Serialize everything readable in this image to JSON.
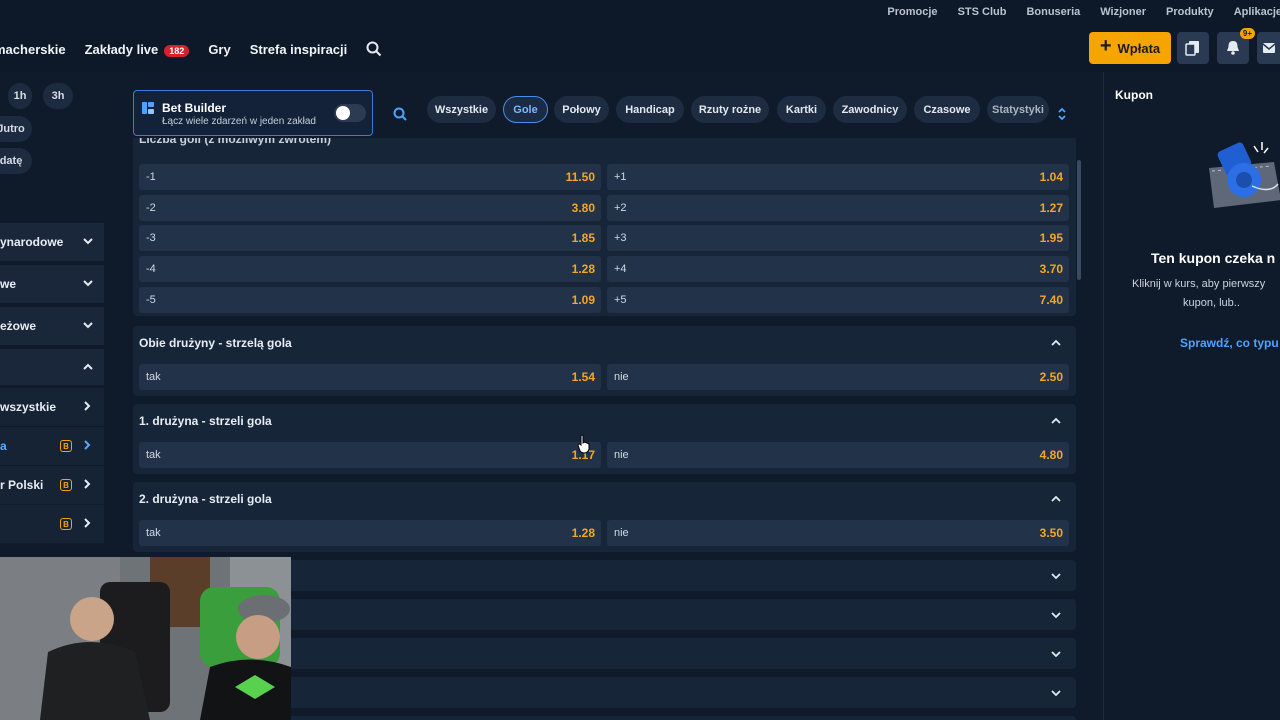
{
  "util_links": [
    "Promocje",
    "STS Club",
    "Bonuseria",
    "Wizjoner",
    "Produkty",
    "Aplikacje"
  ],
  "nav": {
    "bookmaker": "macherskie",
    "live": "Zakłady live",
    "live_count": "182",
    "games": "Gry",
    "inspiration": "Strefa inspiracji"
  },
  "header": {
    "deposit_label": "Wpłata",
    "notif_count": "9+"
  },
  "sidebar": {
    "time_filters": [
      "1h",
      "3h",
      "Jutro",
      "datę"
    ],
    "categories": [
      "ynarodowe",
      "we",
      "eżowe"
    ],
    "sub_items": [
      "wszystkie",
      "a",
      "r Polski",
      ""
    ]
  },
  "bet_builder": {
    "title": "Bet Builder",
    "subtitle": "Łącz wiele zdarzeń w jeden zakład"
  },
  "filters": [
    "Wszystkie",
    "Gole",
    "Połowy",
    "Handicap",
    "Rzuty rożne",
    "Kartki",
    "Zawodnicy",
    "Czasowe",
    "Statystyki"
  ],
  "markets": {
    "partial_title": "Liczba goli (z możliwym zwrotem)",
    "handicap_rows": [
      {
        "l_label": "-1",
        "l_odd": "11.50",
        "r_label": "+1",
        "r_odd": "1.04"
      },
      {
        "l_label": "-2",
        "l_odd": "3.80",
        "r_label": "+2",
        "r_odd": "1.27"
      },
      {
        "l_label": "-3",
        "l_odd": "1.85",
        "r_label": "+3",
        "r_odd": "1.95"
      },
      {
        "l_label": "-4",
        "l_odd": "1.28",
        "r_label": "+4",
        "r_odd": "3.70"
      },
      {
        "l_label": "-5",
        "l_odd": "1.09",
        "r_label": "+5",
        "r_odd": "7.40"
      }
    ],
    "both_score": {
      "title": "Obie drużyny - strzelą gola",
      "yes": "tak",
      "yes_odd": "1.54",
      "no": "nie",
      "no_odd": "2.50"
    },
    "team1": {
      "title": "1. drużyna - strzeli gola",
      "yes": "tak",
      "yes_odd": "1.17",
      "no": "nie",
      "no_odd": "4.80"
    },
    "team2": {
      "title": "2. drużyna - strzeli gola",
      "yes": "tak",
      "yes_odd": "1.28",
      "no": "nie",
      "no_odd": "3.50"
    }
  },
  "coupon": {
    "title": "Kupon",
    "heading": "Ten kupon czeka n",
    "line1": "Kliknij w kurs, aby pierwszy",
    "line2": "kupon, lub..",
    "link": "Sprawdź, co typu"
  },
  "colors": {
    "accent": "#f6a500",
    "odd": "#f5a623",
    "link": "#4da3ff",
    "bg": "#0f1a2b"
  }
}
